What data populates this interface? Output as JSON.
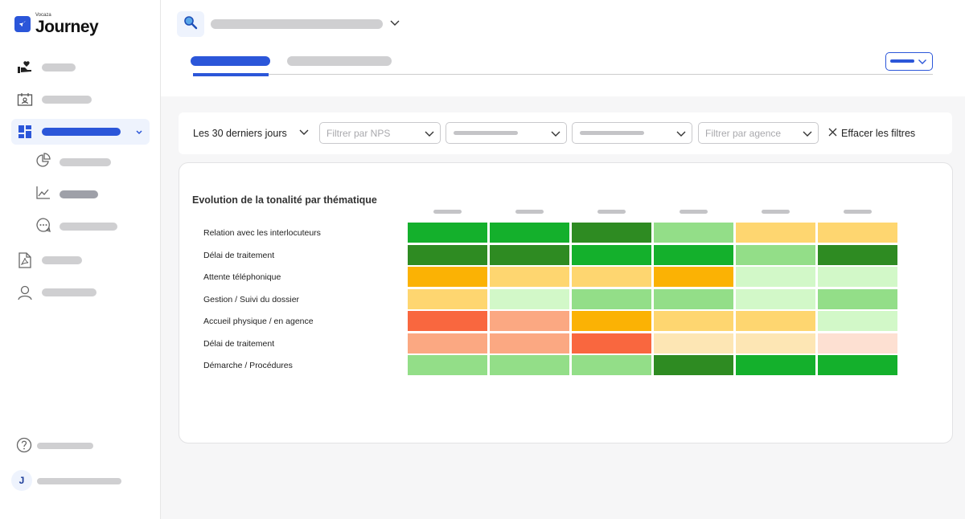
{
  "app": {
    "brand_small": "Vocaza",
    "brand_name": "Journey",
    "user_initial": "J"
  },
  "sidebar": {
    "items": [
      {
        "icon": "hand-heart-icon"
      },
      {
        "icon": "contact-card-icon"
      },
      {
        "icon": "dashboard-icon",
        "active": true,
        "subitems": [
          {
            "icon": "pie-chart-icon"
          },
          {
            "icon": "line-chart-icon"
          },
          {
            "icon": "chat-bubble-icon"
          }
        ]
      },
      {
        "icon": "pdf-file-icon"
      },
      {
        "icon": "user-icon"
      }
    ],
    "footer": [
      {
        "icon": "help-icon"
      }
    ]
  },
  "filters": {
    "period": "Les 30 derniers jours",
    "nps_placeholder": "Filtrer par NPS",
    "agency_placeholder": "Filtrer par agence",
    "clear_label": "Effacer les filtres"
  },
  "colors": {
    "accent": "#2b56d9",
    "very_positive": "#2e8b22",
    "positive": "#14b02c",
    "mildly_positive": "#93de88",
    "slightly_positive": "#d2f8c8",
    "neutral_light": "#fde6b4",
    "neutral": "#fed670",
    "warning": "#fbb204",
    "negative": "#fba882",
    "very_negative": "#f9673f",
    "slightly_negative": "#fde0d2"
  },
  "heatmap": {
    "title": "Evolution de la tonalité par thématique",
    "rows": [
      {
        "label": "Relation avec les interlocuteurs",
        "cells": [
          "#14b02c",
          "#14b02c",
          "#2e8b22",
          "#93de88",
          "#fed670",
          "#fed670"
        ]
      },
      {
        "label": "Délai de traitement",
        "cells": [
          "#2e8b22",
          "#2e8b22",
          "#14b02c",
          "#14b02c",
          "#93de88",
          "#2e8b22"
        ]
      },
      {
        "label": "Attente téléphonique",
        "cells": [
          "#fbb204",
          "#fed670",
          "#fed670",
          "#fbb204",
          "#d2f8c8",
          "#d2f8c8"
        ]
      },
      {
        "label": "Gestion / Suivi du dossier",
        "cells": [
          "#fed670",
          "#d2f8c8",
          "#93de88",
          "#93de88",
          "#d2f8c8",
          "#93de88"
        ]
      },
      {
        "label": "Accueil physique / en agence",
        "cells": [
          "#f9673f",
          "#fba882",
          "#fbb204",
          "#fed670",
          "#fed670",
          "#d2f8c8"
        ]
      },
      {
        "label": "Délai de traitement",
        "cells": [
          "#fba882",
          "#fba882",
          "#f9673f",
          "#fde6b4",
          "#fde6b4",
          "#fde0d2"
        ]
      },
      {
        "label": "Démarche / Procédures",
        "cells": [
          "#93de88",
          "#93de88",
          "#93de88",
          "#2e8b22",
          "#14b02c",
          "#14b02c"
        ]
      }
    ]
  }
}
